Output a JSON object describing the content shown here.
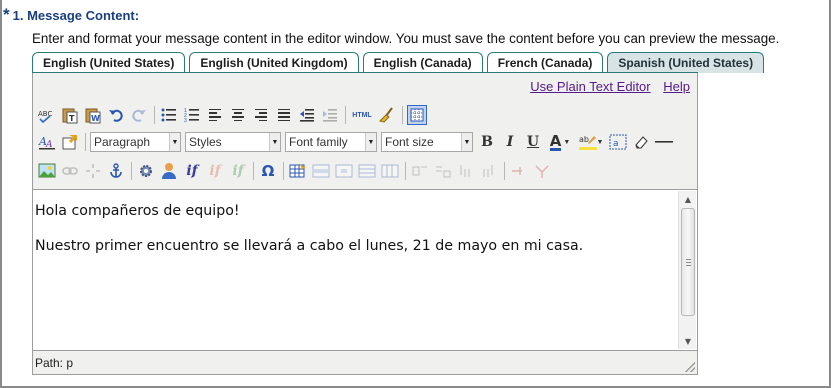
{
  "section": {
    "required_marker": "*",
    "heading": "1. Message Content:",
    "instructions": "Enter and format your message content in the editor window. You must save the content before you can preview the message."
  },
  "tabs": [
    {
      "label": "English (United States)",
      "active": false
    },
    {
      "label": "English (United Kingdom)",
      "active": false
    },
    {
      "label": "English (Canada)",
      "active": false
    },
    {
      "label": "French (Canada)",
      "active": false
    },
    {
      "label": "Spanish (United States)",
      "active": true
    }
  ],
  "editor_links": {
    "plain_text": "Use Plain Text Editor",
    "help": "Help"
  },
  "toolbar": {
    "html_label": "HTML",
    "format_select": "Paragraph",
    "styles_select": "Styles",
    "font_family_select": "Font family",
    "font_size_select": "Font size",
    "bold": "B",
    "italic": "I",
    "underline": "U",
    "font_color": "A",
    "omega": "Ω",
    "if_label": "if"
  },
  "content": {
    "line1": "Hola compañeros de equipo!",
    "line2": "Nuestro primer encuentro se llevará a cabo el lunes, 21 de mayo en mi casa."
  },
  "status": {
    "path": "Path: p"
  },
  "colors": {
    "heading": "#1a3e80",
    "tab_border": "#2a7a78",
    "active_tab_bg": "#d8e3e6",
    "link": "#551a8b"
  }
}
